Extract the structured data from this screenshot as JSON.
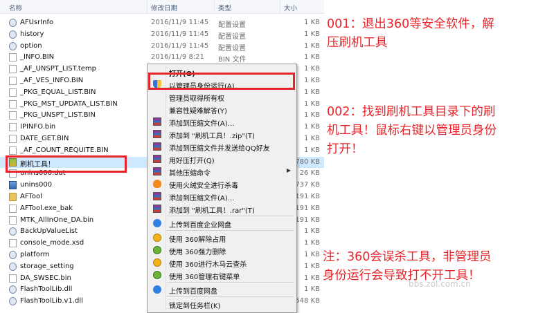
{
  "explorer": {
    "columns": {
      "name": "名称",
      "date": "修改日期",
      "type": "类型",
      "size": "大小"
    },
    "files": [
      {
        "name": "AFUsrInfo",
        "date": "2016/11/9 11:45",
        "type": "配置设置",
        "size": "1 KB",
        "icon": "gear"
      },
      {
        "name": "history",
        "date": "2016/11/9 11:45",
        "type": "配置设置",
        "size": "1 KB",
        "icon": "gear"
      },
      {
        "name": "option",
        "date": "2016/11/9 11:45",
        "type": "配置设置",
        "size": "1 KB",
        "icon": "gear"
      },
      {
        "name": "_INFO.BIN",
        "date": "2016/11/9 8:21",
        "type": "BIN 文件",
        "size": "1 KB",
        "icon": "doc"
      },
      {
        "name": "_AF_UNSPT_LIST.temp",
        "date": "",
        "type": "",
        "size": "1 KB",
        "icon": "doc"
      },
      {
        "name": "_AF_VES_INFO.BIN",
        "date": "",
        "type": "",
        "size": "1 KB",
        "icon": "doc"
      },
      {
        "name": "_PKG_EQUAL_LIST.BIN",
        "date": "",
        "type": "",
        "size": "1 KB",
        "icon": "doc"
      },
      {
        "name": "_PKG_MST_UPDATA_LIST.BIN",
        "date": "",
        "type": "",
        "size": "1 KB",
        "icon": "doc"
      },
      {
        "name": "_PKG_UNSPT_LIST.BIN",
        "date": "",
        "type": "",
        "size": "1 KB",
        "icon": "doc"
      },
      {
        "name": "IPINFO.bin",
        "date": "",
        "type": "",
        "size": "1 KB",
        "icon": "doc"
      },
      {
        "name": "DATE_GET.BIN",
        "date": "",
        "type": "",
        "size": "1 KB",
        "icon": "doc"
      },
      {
        "name": "_AF_COUNT_REQUITE.BIN",
        "date": "",
        "type": "",
        "size": "1 KB",
        "icon": "doc"
      },
      {
        "name": "刷机工具！",
        "date": "",
        "type": "",
        "size": "780 KB",
        "icon": "exe",
        "selected": true
      },
      {
        "name": "unins000.dat",
        "date": "",
        "type": "",
        "size": "26 KB",
        "icon": "doc"
      },
      {
        "name": "unins000",
        "date": "",
        "type": "",
        "size": "737 KB",
        "icon": "app"
      },
      {
        "name": "AFTool",
        "date": "",
        "type": "",
        "size": "191 KB",
        "icon": "folder"
      },
      {
        "name": "AFTool.exe_bak",
        "date": "",
        "type": "",
        "size": "191 KB",
        "icon": "doc"
      },
      {
        "name": "MTK_AllInOne_DA.bin",
        "date": "",
        "type": "",
        "size": "191 KB",
        "icon": "doc"
      },
      {
        "name": "BackUpValueList",
        "date": "",
        "type": "",
        "size": "1 KB",
        "icon": "gear"
      },
      {
        "name": "console_mode.xsd",
        "date": "",
        "type": "",
        "size": "1 KB",
        "icon": "doc"
      },
      {
        "name": "platform",
        "date": "",
        "type": "",
        "size": "1 KB",
        "icon": "gear"
      },
      {
        "name": "storage_setting",
        "date": "",
        "type": "",
        "size": "1 KB",
        "icon": "gear"
      },
      {
        "name": "DA_SWSEC.bin",
        "date": "",
        "type": "",
        "size": "1 KB",
        "icon": "doc"
      },
      {
        "name": "FlashToolLib.dll",
        "date": "",
        "type": "",
        "size": "1 KB",
        "icon": "gear"
      },
      {
        "name": "FlashToolLib.v1.dll",
        "date": "",
        "type": "",
        "size": "548 KB",
        "icon": "gear"
      }
    ]
  },
  "context_menu": {
    "items": [
      {
        "label": "打开(O)",
        "icon": "",
        "bold": true
      },
      {
        "label": "以管理员身份运行(A)",
        "icon": "shield",
        "highlight": true
      },
      {
        "label": "管理员取得所有权",
        "icon": ""
      },
      {
        "label": "兼容性疑难解答(Y)",
        "icon": ""
      },
      {
        "label": "添加到压缩文件(A)...",
        "icon": "rar"
      },
      {
        "label": "添加到 \"刷机工具！.zip\"(T)",
        "icon": "rar"
      },
      {
        "label": "添加到压缩文件并发送给QQ好友",
        "icon": "rar"
      },
      {
        "label": "用好压打开(Q)",
        "icon": "rar"
      },
      {
        "label": "其他压缩命令",
        "icon": "rar",
        "submenu": true
      },
      {
        "label": "使用火绒安全进行杀毒",
        "icon": "fire"
      },
      {
        "label": "添加到压缩文件(A)...",
        "icon": "rar"
      },
      {
        "label": "添加到 \"刷机工具！.rar\"(T)",
        "icon": "rar",
        "sep_after": true
      },
      {
        "label": "上传到百度企业网盘",
        "icon": "baidu",
        "sep_after": true
      },
      {
        "label": "使用 360解除占用",
        "icon": "360y"
      },
      {
        "label": "使用 360强力删除",
        "icon": "360"
      },
      {
        "label": "使用 360进行木马云查杀",
        "icon": "360y"
      },
      {
        "label": "使用 360管理右键菜单",
        "icon": "360",
        "sep_after": true
      },
      {
        "label": "上传到百度网盘",
        "icon": "baidu",
        "sep_after": true
      },
      {
        "label": "锁定到任务栏(K)",
        "icon": ""
      }
    ]
  },
  "annotations": {
    "step1_line1": "001：退出360等安全软件，解",
    "step1_line2": "压刷机工具",
    "step2_line1": "002：找到刷机工具目录下的刷",
    "step2_line2": "机工具！鼠标右键以管理员身份",
    "step2_line3": "打开！",
    "note_line1": "注：360会误杀工具，非管理员",
    "note_line2": "身份运行会导致打不开工具！"
  },
  "watermark": "bbs.zol.com.cn",
  "colors": {
    "highlight_red": "#e8242a",
    "selection_blue": "#cde8ff",
    "menu_bg": "#f0f0f0"
  }
}
